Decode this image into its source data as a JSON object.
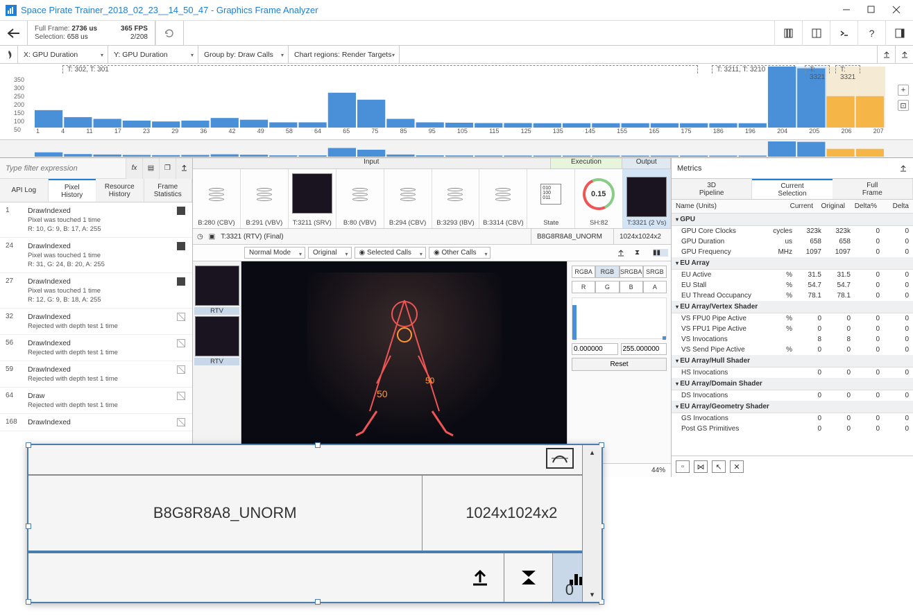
{
  "title": "Space Pirate Trainer_2018_02_23__14_50_47 - Graphics Frame Analyzer",
  "frame": {
    "fullLabel": "Full Frame:",
    "fullVal": "2736 us",
    "selLabel": "Selection:",
    "selVal": "658 us",
    "fpsLabel": "365 FPS",
    "ratio": "2/208"
  },
  "axes": {
    "x": "X: GPU Duration",
    "y": "Y: GPU Duration",
    "group": "Group by: Draw Calls",
    "regions": "Chart regions: Render Targets"
  },
  "annotations": {
    "a1": "T: 302, T: 301",
    "a2": "T: 3211, T: 3210",
    "a3": "T: 3321",
    "a4": "T: 3321"
  },
  "chart_data": {
    "type": "bar",
    "ylabel": "",
    "xlabel": "",
    "ylim": [
      0,
      350
    ],
    "yticks": [
      350,
      300,
      250,
      200,
      150,
      100,
      50
    ],
    "xticks": [
      "1",
      "4",
      "11",
      "17",
      "23",
      "29",
      "36",
      "42",
      "49",
      "58",
      "64",
      "65",
      "75",
      "85",
      "95",
      "105",
      "115",
      "125",
      "135",
      "145",
      "155",
      "165",
      "175",
      "186",
      "196",
      "204",
      "205",
      "206",
      "207"
    ],
    "values": [
      100,
      60,
      50,
      40,
      35,
      40,
      55,
      45,
      30,
      30,
      200,
      160,
      50,
      30,
      28,
      26,
      26,
      25,
      25,
      25,
      25,
      25,
      25,
      25,
      25,
      350,
      340,
      180,
      180
    ],
    "highlight": {
      "start": 25,
      "end": 28,
      "secondary_color": "#f5b547"
    }
  },
  "filter": {
    "placeholder": "Type filter expression"
  },
  "leftTabs": [
    "API Log",
    "Pixel\nHistory",
    "Resource\nHistory",
    "Frame\nStatistics"
  ],
  "history": [
    {
      "n": "1",
      "name": "DrawIndexed",
      "d1": "Pixel was touched 1 time",
      "d2": "R: 10, G: 9, B: 17, A: 255",
      "badge": "sq"
    },
    {
      "n": "24",
      "name": "DrawIndexed",
      "d1": "Pixel was touched 1 time",
      "d2": "R: 31, G: 24, B: 20, A: 255",
      "badge": "sq"
    },
    {
      "n": "27",
      "name": "DrawIndexed",
      "d1": "Pixel was touched 1 time",
      "d2": "R: 12, G: 9, B: 18, A: 255",
      "badge": "sq"
    },
    {
      "n": "32",
      "name": "DrawIndexed",
      "d1": "Rejected with depth test 1 time",
      "d2": "",
      "badge": "no"
    },
    {
      "n": "56",
      "name": "DrawIndexed",
      "d1": "Rejected with depth test 1 time",
      "d2": "",
      "badge": "no"
    },
    {
      "n": "59",
      "name": "DrawIndexed",
      "d1": "Rejected with depth test 1 time",
      "d2": "",
      "badge": "no"
    },
    {
      "n": "64",
      "name": "Draw",
      "d1": "Rejected with depth test 1 time",
      "d2": "",
      "badge": "no"
    },
    {
      "n": "168",
      "name": "DrawIndexed",
      "d1": "",
      "d2": "",
      "badge": "no"
    }
  ],
  "ioHdr": {
    "input": "Input",
    "exec": "Execution",
    "output": "Output"
  },
  "thumbs": [
    {
      "lbl": "B:280 (CBV)",
      "t": "db"
    },
    {
      "lbl": "B:291 (VBV)",
      "t": "db"
    },
    {
      "lbl": "T:3211 (SRV)",
      "t": "img"
    },
    {
      "lbl": "B:80 (VBV)",
      "t": "db"
    },
    {
      "lbl": "B:294 (CBV)",
      "t": "db"
    },
    {
      "lbl": "B:3293 (IBV)",
      "t": "db"
    },
    {
      "lbl": "B:3314 (CBV)",
      "t": "db"
    },
    {
      "lbl": "State",
      "t": "state"
    }
  ],
  "gauge": "0.15",
  "outp": {
    "lbl": "T:3321 (2 Vs)",
    "sh": "SH:82"
  },
  "info": {
    "rtv": "T:3321 (RTV) (Final)",
    "fmt": "B8G8R8A8_UNORM",
    "dim": "1024x1024x2"
  },
  "viewCtrl": {
    "mode": "Normal Mode",
    "orig": "Original",
    "sel": "Selected Calls",
    "other": "Other Calls"
  },
  "rtv": "RTV",
  "channels": {
    "row1": [
      "RGBA",
      "RGB",
      "SRGBA",
      "SRGB"
    ],
    "row2": [
      "R",
      "G",
      "B",
      "A"
    ]
  },
  "range": {
    "lo": "0.000000",
    "hi": "255.000000",
    "reset": "Reset"
  },
  "pct": "44%",
  "metricsLbl": "Metrics",
  "pipeTabs": [
    "3D\nPipeline",
    "Current\nSelection",
    "Full\nFrame"
  ],
  "mtHead": [
    "Name (Units)",
    "Current",
    "Original",
    "Delta%",
    "Delta"
  ],
  "metrics": [
    {
      "g": "GPU",
      "rows": [
        {
          "n": "GPU Core Clocks",
          "u": "cycles",
          "c": "323k",
          "o": "323k",
          "dp": "0",
          "d": "0"
        },
        {
          "n": "GPU Duration",
          "u": "us",
          "c": "658",
          "o": "658",
          "dp": "0",
          "d": "0"
        },
        {
          "n": "GPU Frequency",
          "u": "MHz",
          "c": "1097",
          "o": "1097",
          "dp": "0",
          "d": "0"
        }
      ]
    },
    {
      "g": "EU Array",
      "rows": [
        {
          "n": "EU Active",
          "u": "%",
          "c": "31.5",
          "o": "31.5",
          "dp": "0",
          "d": "0"
        },
        {
          "n": "EU Stall",
          "u": "%",
          "c": "54.7",
          "o": "54.7",
          "dp": "0",
          "d": "0"
        },
        {
          "n": "EU Thread Occupancy",
          "u": "%",
          "c": "78.1",
          "o": "78.1",
          "dp": "0",
          "d": "0"
        }
      ]
    },
    {
      "g": "EU Array/Vertex Shader",
      "rows": [
        {
          "n": "VS FPU0 Pipe Active",
          "u": "%",
          "c": "0",
          "o": "0",
          "dp": "0",
          "d": "0"
        },
        {
          "n": "VS FPU1 Pipe Active",
          "u": "%",
          "c": "0",
          "o": "0",
          "dp": "0",
          "d": "0"
        },
        {
          "n": "VS Invocations",
          "u": "",
          "c": "8",
          "o": "8",
          "dp": "0",
          "d": "0"
        },
        {
          "n": "VS Send Pipe Active",
          "u": "%",
          "c": "0",
          "o": "0",
          "dp": "0",
          "d": "0"
        }
      ]
    },
    {
      "g": "EU Array/Hull Shader",
      "rows": [
        {
          "n": "HS Invocations",
          "u": "",
          "c": "0",
          "o": "0",
          "dp": "0",
          "d": "0"
        }
      ]
    },
    {
      "g": "EU Array/Domain Shader",
      "rows": [
        {
          "n": "DS Invocations",
          "u": "",
          "c": "0",
          "o": "0",
          "dp": "0",
          "d": "0"
        }
      ]
    },
    {
      "g": "EU Array/Geometry Shader",
      "rows": [
        {
          "n": "GS Invocations",
          "u": "",
          "c": "0",
          "o": "0",
          "dp": "0",
          "d": "0"
        },
        {
          "n": "Post GS Primitives",
          "u": "",
          "c": "0",
          "o": "0",
          "dp": "0",
          "d": "0"
        }
      ]
    }
  ],
  "zoom": {
    "fmt": "B8G8R8A8_UNORM",
    "dim": "1024x1024x2"
  }
}
